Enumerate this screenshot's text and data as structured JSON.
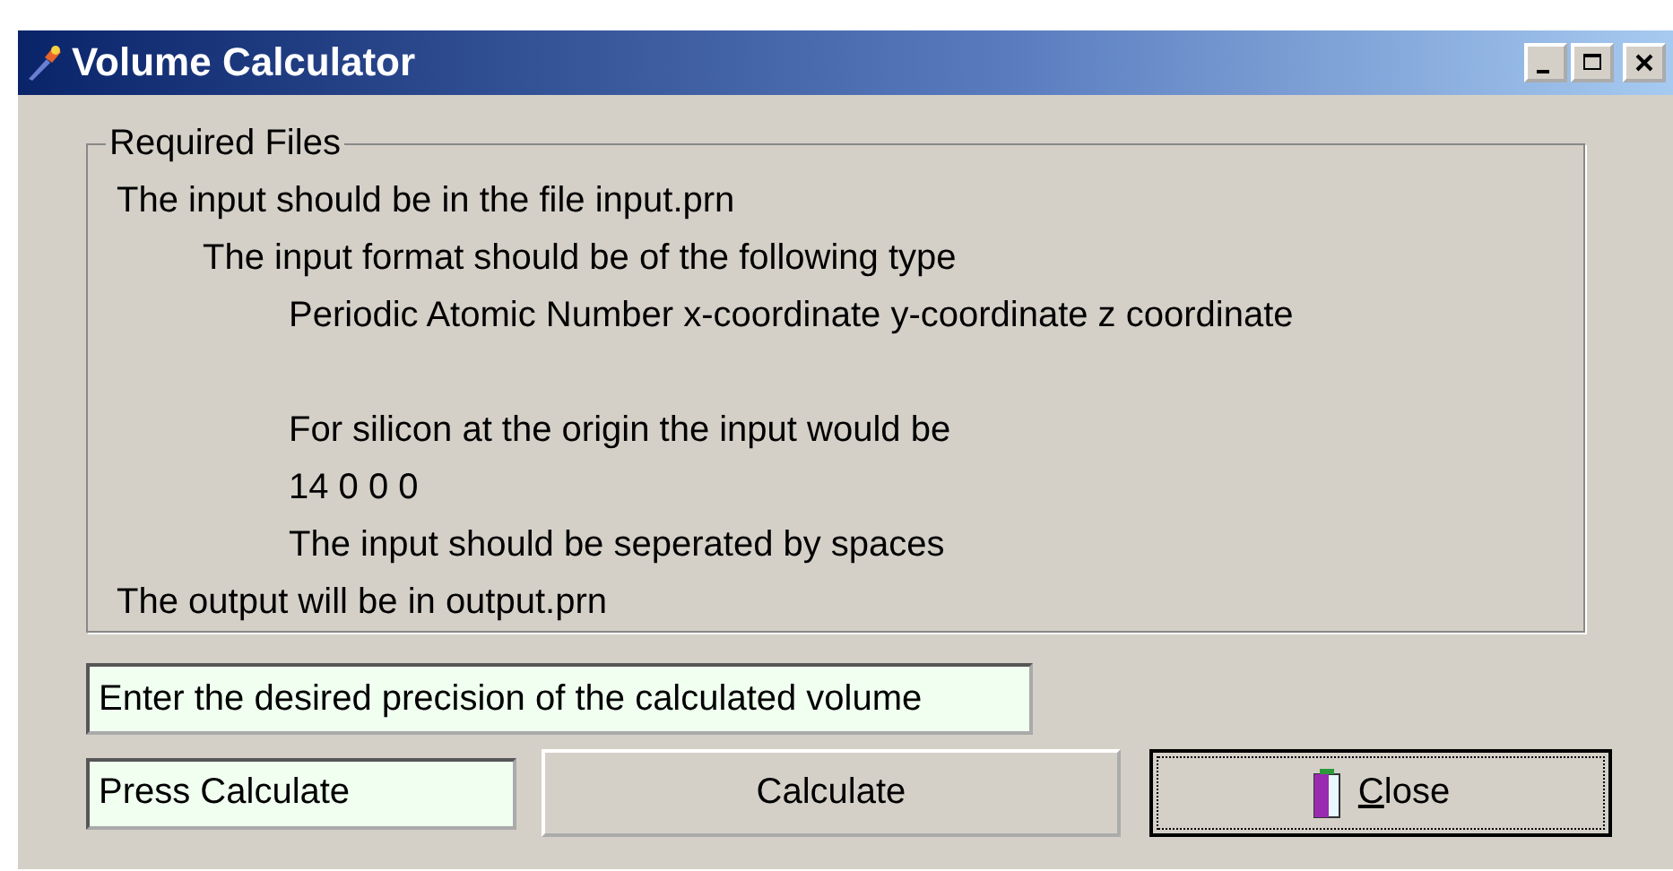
{
  "window": {
    "title": "Volume Calculator"
  },
  "group": {
    "title": "Required Files",
    "lines": [
      {
        "text": "The input should be in the file input.prn",
        "spaced_before": false,
        "children": [
          {
            "text": "The input format should be of the following type",
            "spaced_before": false,
            "children": [
              {
                "text": "Periodic Atomic Number  x-coordinate y-coordinate z coordinate",
                "spaced_before": false
              },
              {
                "text": "For silicon at the origin the input would be",
                "spaced_before": true
              },
              {
                "text": "14 0 0 0",
                "spaced_before": false
              },
              {
                "text": "The input should be seperated by spaces",
                "spaced_before": false
              }
            ]
          }
        ]
      },
      {
        "text": "The output will be in output.prn",
        "spaced_before": false
      }
    ]
  },
  "precision_field": {
    "value": "Enter the desired precision of the calculated volume"
  },
  "status_field": {
    "value": "Press Calculate"
  },
  "buttons": [
    {
      "label": "Calculate",
      "kind": "plain"
    },
    {
      "label": "Close",
      "kind": "default"
    }
  ]
}
